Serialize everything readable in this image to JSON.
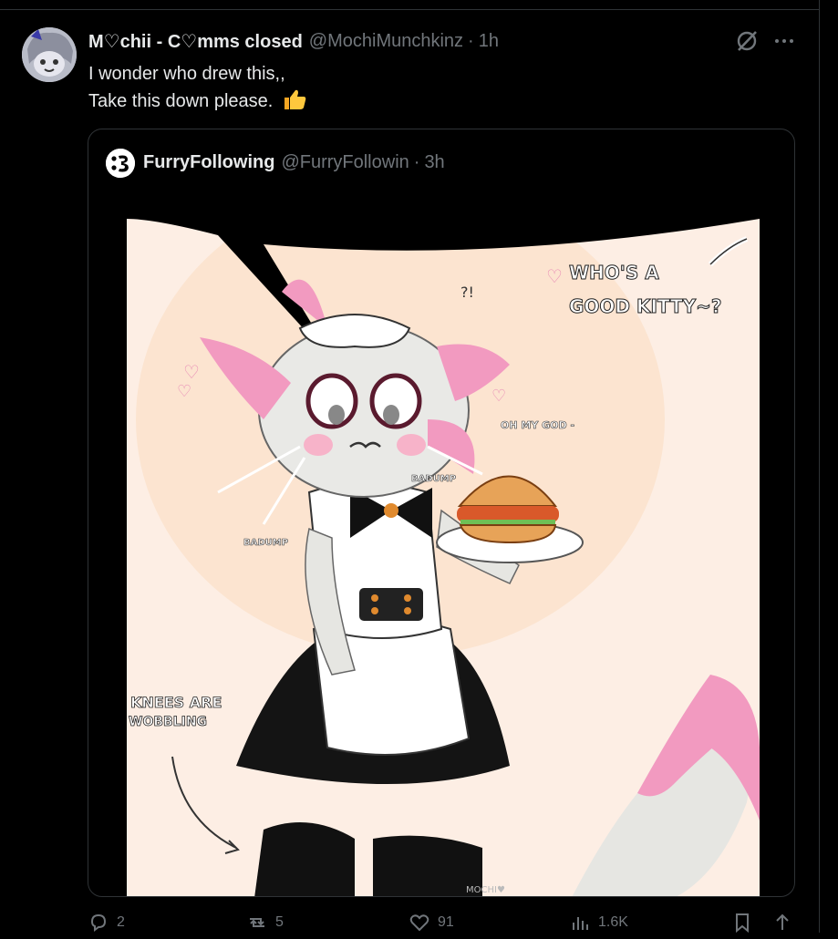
{
  "tweet": {
    "display_name": "M♡chii - C♡mms closed",
    "handle": "@MochiMunchkinz",
    "separator": "·",
    "time": "1h",
    "line1": "I wonder who drew this,,",
    "line2": "Take this down please.",
    "emoji_icon": "thumbs-up-icon"
  },
  "quote": {
    "display_name": "FurryFollowing",
    "handle": "@FurryFollowin",
    "separator": "·",
    "time": "3h",
    "image": {
      "speech": [
        "WHO'S A",
        "GOOD KITTY~?"
      ],
      "small_texts": [
        "?!",
        "OH MY GOD -",
        "BADUMP",
        "BADUMP"
      ],
      "knees": [
        "KNEES ARE",
        "WOBBLING"
      ],
      "signature": "MOCHI♥"
    }
  },
  "actions": {
    "replies": "2",
    "reposts": "5",
    "likes": "91",
    "views": "1.6K"
  },
  "colors": {
    "bg": "#000000",
    "text": "#e7e9ea",
    "muted": "#71767b",
    "border": "#2f3336",
    "pink": "#f29ac0"
  }
}
